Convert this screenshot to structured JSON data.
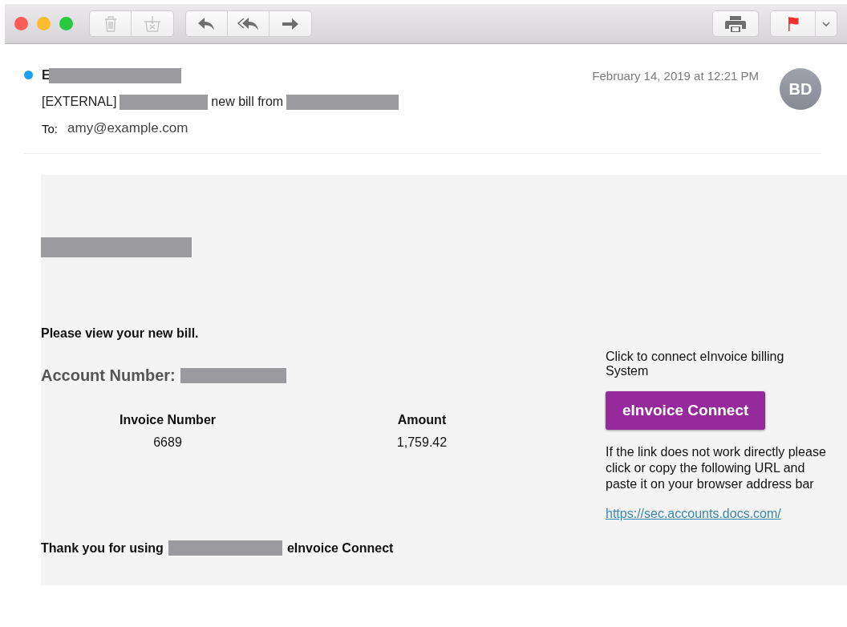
{
  "toolbar": {
    "groups": [
      {
        "buttons": [
          {
            "kind": "trash",
            "disabled": true
          },
          {
            "kind": "junk",
            "disabled": true
          }
        ]
      },
      {
        "buttons": [
          {
            "kind": "reply",
            "disabled": false
          },
          {
            "kind": "reply-all",
            "disabled": false
          },
          {
            "kind": "forward",
            "disabled": false
          }
        ]
      }
    ],
    "right": [
      {
        "kind": "print",
        "disabled": false
      },
      {
        "kind": "flag",
        "disabled": false,
        "menu": true
      }
    ]
  },
  "header": {
    "unread": true,
    "sender": [
      {
        "kind": "text",
        "text": "E"
      },
      {
        "kind": "redacted"
      }
    ],
    "subject": [
      {
        "kind": "text",
        "text": "[EXTERNAL]"
      },
      {
        "kind": "redacted"
      },
      {
        "kind": "text",
        "text": "new bill from"
      },
      {
        "kind": "redacted"
      }
    ],
    "to_label": "To:",
    "to": "amy@example.com",
    "date": "February 14, 2019 at 12:21 PM",
    "avatar": "BD"
  },
  "message": {
    "logo": [
      {
        "kind": "redacted"
      }
    ],
    "intro": "Please view your new bill.",
    "account": [
      {
        "kind": "text",
        "text": "Account Number:"
      },
      {
        "kind": "redacted"
      }
    ],
    "table": {
      "columns": [
        "Invoice Number",
        "Amount"
      ],
      "rows": [
        [
          "6689",
          "1,759.42"
        ]
      ]
    },
    "thanks": [
      {
        "kind": "text",
        "text": "Thank you for using"
      },
      {
        "kind": "redacted"
      },
      {
        "kind": "text",
        "text": "eInvoice Connect"
      }
    ],
    "cta_text": "Click to connect eInvoice billing System",
    "cta_button": "eInvoice Connect",
    "fallback": "If the link does not work directly please click or copy the following URL and paste it on your browser address bar",
    "url": "https://sec.accounts.docs.com/"
  }
}
